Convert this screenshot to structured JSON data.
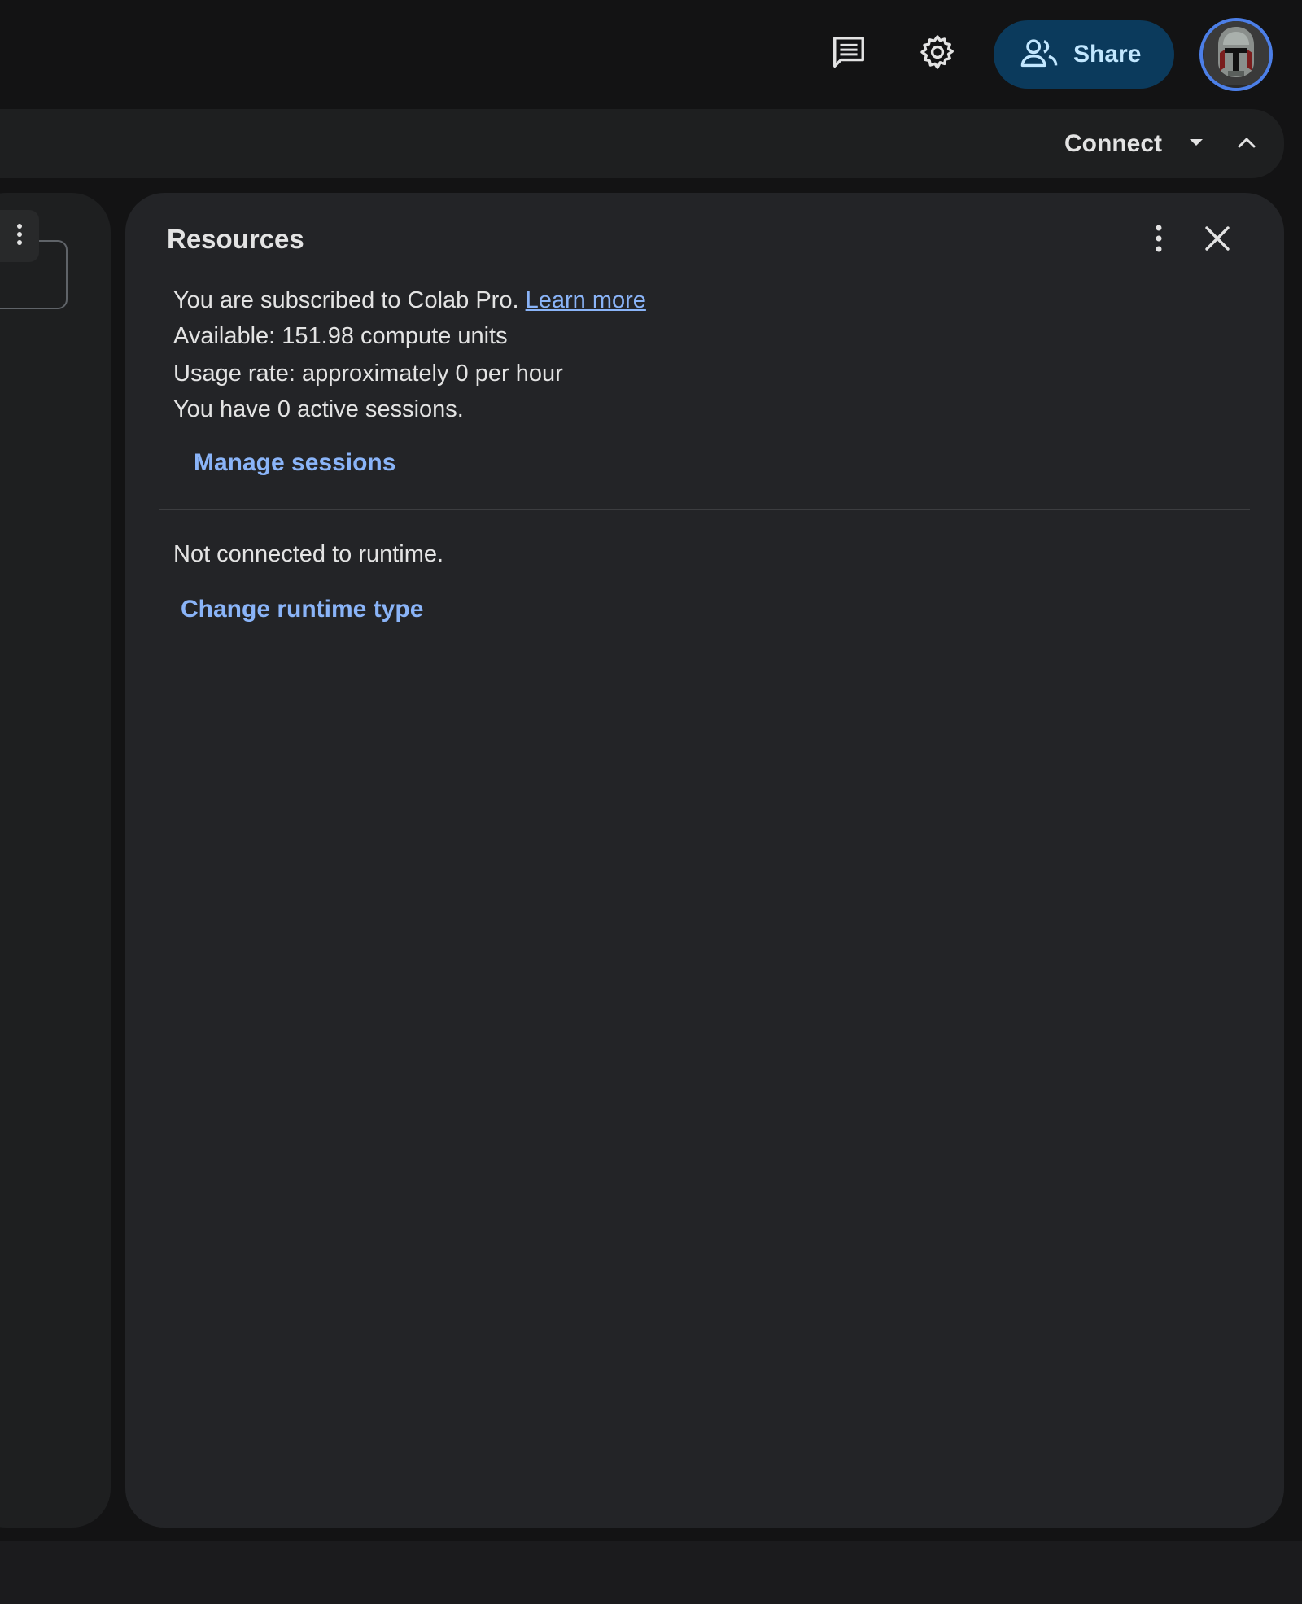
{
  "header": {
    "share_label": "Share"
  },
  "toolbar": {
    "connect_label": "Connect"
  },
  "resources": {
    "title": "Resources",
    "subscription_text": "You are subscribed to Colab Pro.",
    "learn_more_label": "Learn more",
    "available_text": "Available: 151.98 compute units",
    "usage_text": "Usage rate: approximately 0 per hour",
    "sessions_text": "You have 0 active sessions.",
    "manage_sessions_label": "Manage sessions",
    "runtime_status_text": "Not connected to runtime.",
    "change_runtime_label": "Change runtime type"
  },
  "colors": {
    "link": "#8ab4f8",
    "share_bg": "#0b3a5c",
    "share_text": "#c2e7ff",
    "panel_bg": "#232427",
    "avatar_ring": "#4c7fe8"
  },
  "icons": {
    "comment": "comment-icon",
    "settings": "gear-icon",
    "share": "people-icon",
    "connect_dropdown": "caret-down-icon",
    "collapse": "chevron-up-icon",
    "panel_more": "more-vert-icon",
    "panel_close": "close-icon",
    "left_more": "more-vert-icon",
    "avatar": "helmet-avatar-icon"
  }
}
